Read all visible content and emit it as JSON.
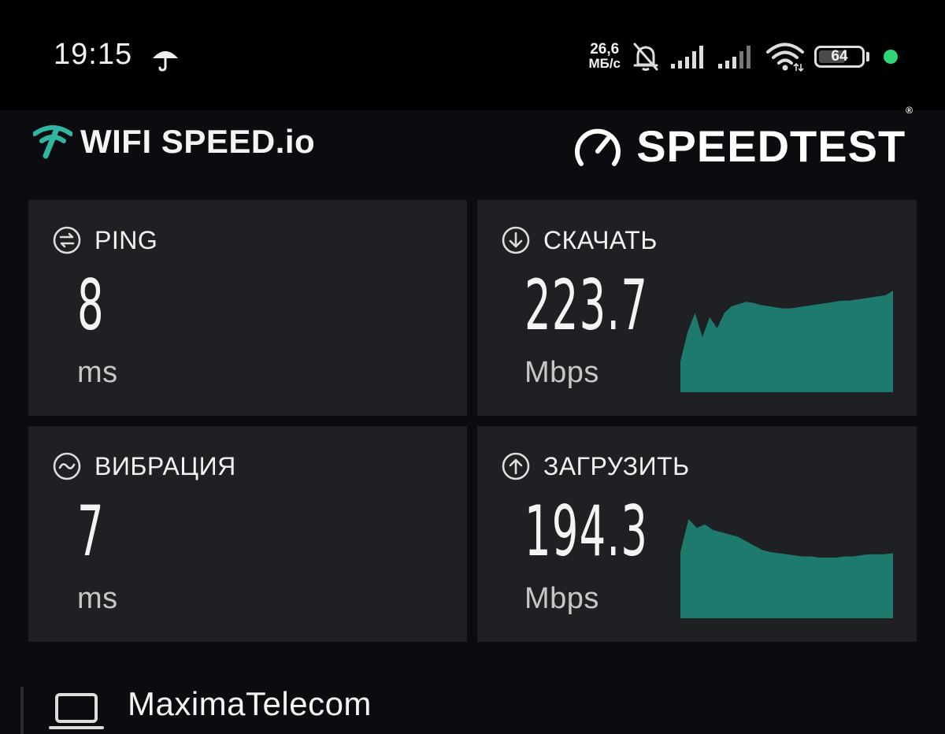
{
  "status_bar": {
    "time": "19:15",
    "net_speed_value": "26,6",
    "net_speed_unit": "МБ/с",
    "battery_level": "64",
    "battery_fraction": 0.64,
    "icons": [
      "umbrella-icon",
      "bell-muted-icon",
      "signal-icon",
      "signal-icon",
      "wifi-icon",
      "battery-icon",
      "status-dot"
    ]
  },
  "header": {
    "wifi_brand": "WIFI SPEED.io",
    "speedtest_brand": "SPEEDTEST",
    "speedtest_reg": "®"
  },
  "metrics": {
    "ping": {
      "label": "PING",
      "value": "8",
      "unit": "ms",
      "icon": "ping-icon"
    },
    "download": {
      "label": "СКАЧАТЬ",
      "value": "223.7",
      "unit": "Mbps",
      "icon": "download-arrow-icon"
    },
    "jitter": {
      "label": "ВИБРАЦИЯ",
      "value": "7",
      "unit": "ms",
      "icon": "jitter-wave-icon"
    },
    "upload": {
      "label": "ЗАГРУЗИТЬ",
      "value": "194.3",
      "unit": "Mbps",
      "icon": "upload-arrow-icon"
    }
  },
  "network": {
    "name": "MaximaTelecom",
    "icon": "laptop-icon"
  },
  "colors": {
    "accent": "#1d7a6c",
    "card": "#1f2024",
    "background": "#0b0c10",
    "wifi_logo": "#2fb5a0"
  },
  "download_trend": [
    0.28,
    0.55,
    0.72,
    0.5,
    0.68,
    0.58,
    0.72,
    0.78,
    0.8,
    0.82,
    0.81,
    0.79,
    0.78,
    0.77,
    0.76,
    0.76,
    0.77,
    0.78,
    0.79,
    0.8,
    0.81,
    0.82,
    0.83,
    0.83,
    0.84,
    0.85,
    0.86,
    0.87,
    0.88,
    0.92
  ],
  "upload_trend": [
    0.6,
    0.9,
    0.82,
    0.85,
    0.8,
    0.78,
    0.76,
    0.74,
    0.7,
    0.66,
    0.62,
    0.6,
    0.59,
    0.58,
    0.57,
    0.56,
    0.56,
    0.55,
    0.55,
    0.55,
    0.56,
    0.56,
    0.57,
    0.58,
    0.58,
    0.58,
    0.59
  ]
}
